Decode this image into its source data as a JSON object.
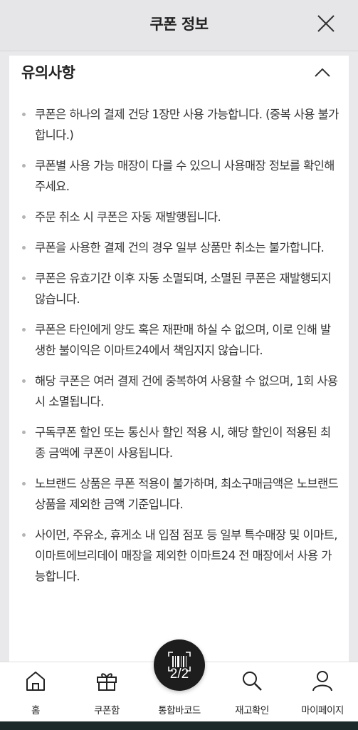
{
  "header": {
    "title": "쿠폰 정보"
  },
  "section": {
    "title": "유의사항",
    "notes": [
      "쿠폰은 하나의 결제 건당 1장만 사용 가능합니다. (중복 사용 불가합니다.)",
      "쿠폰별 사용 가능 매장이 다를 수 있으니 사용매장 정보를 확인해주세요.",
      "주문 취소 시 쿠폰은 자동 재발행됩니다.",
      "쿠폰을 사용한 결제 건의 경우 일부 상품만 취소는 불가합니다.",
      "쿠폰은 유효기간 이후 자동 소멸되며, 소멸된 쿠폰은 재발행되지 않습니다.",
      "쿠폰은 타인에게 양도 혹은 재판매 하실 수 없으며, 이로 인해 발생한 불이익은 이마트24에서 책임지지 않습니다.",
      "해당 쿠폰은 여러 결제 건에 중복하여 사용할 수 없으며, 1회 사용 시 소멸됩니다.",
      "구독쿠폰 할인 또는 통신사 할인 적용 시, 해당 할인이 적용된 최종 금액에 쿠폰이 사용됩니다.",
      "노브랜드 상품은 쿠폰 적용이 불가하며, 최소구매금액은 노브랜드 상품을 제외한 금액 기준입니다.",
      "사이먼, 주유소, 휴게소 내 입점 점포 등 일부 특수매장 및 이마트, 이마트에브리데이 매장을 제외한 이마트24 전 매장에서 사용 가능합니다."
    ]
  },
  "tabbar": {
    "home": "홈",
    "coupon_box": "쿠폰함",
    "barcode": "통합바코드",
    "stock_check": "재고확인",
    "mypage": "마이페이지"
  },
  "fab": {
    "counter": "2/2"
  },
  "icons": {
    "close": "close-icon",
    "collapse": "chevron-up-icon",
    "home": "home-icon",
    "coupon_box": "gift-icon",
    "barcode": "barcode-icon",
    "stock_check": "search-icon",
    "mypage": "user-icon"
  }
}
